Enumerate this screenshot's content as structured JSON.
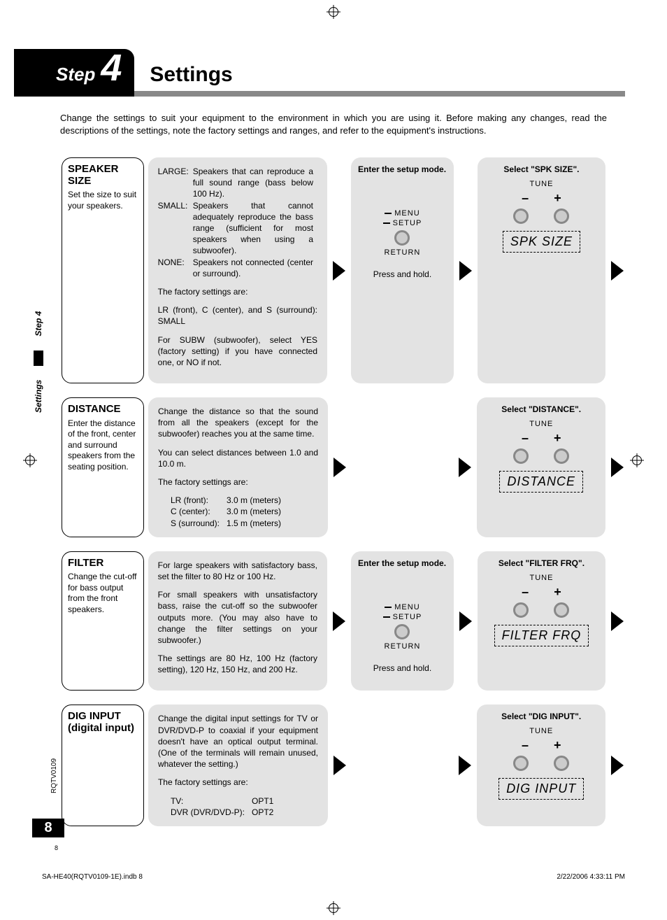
{
  "header": {
    "step_word": "Step",
    "step_num": "4",
    "title": "Settings"
  },
  "intro": "Change the settings to suit your equipment to the environment in which you are using it. Before making any changes, read the descriptions of the settings, note the factory settings and ranges, and refer to the equipment's instructions.",
  "side": {
    "tab1": "Settings",
    "tab2": "Step 4",
    "doc_code": "RQTV0109",
    "page_num": "8",
    "page_num_small": "8"
  },
  "setup_panel": {
    "title": "Enter the setup mode.",
    "menu": "MENU",
    "setup": "SETUP",
    "return": "RETURN",
    "hint": "Press and hold."
  },
  "controls": {
    "tune": "TUNE",
    "minus": "–",
    "plus": "+"
  },
  "rows": [
    {
      "left_title": "SPEAKER SIZE",
      "left_desc": "Set the size to suit your speakers.",
      "defs": [
        {
          "k": "LARGE:",
          "v": "Speakers that can reproduce a full sound range (bass below 100 Hz)."
        },
        {
          "k": "SMALL:",
          "v": "Speakers that cannot adequately reproduce the bass range (sufficient for most speakers when using a subwoofer)."
        },
        {
          "k": "NONE:",
          "v": "Speakers not connected (center or surround)."
        }
      ],
      "para1": "The factory settings are:",
      "para2": "LR (front), C (center), and S (surround): SMALL",
      "para3": "For SUBW (subwoofer), select YES (factory setting) if you have connected one, or NO if not.",
      "right_title": "Select \"SPK SIZE\".",
      "display": "SPK SIZE",
      "show_setup": true
    },
    {
      "left_title": "DISTANCE",
      "left_desc": "Enter the distance of the front, center and surround speakers from the seating position.",
      "paraA": "Change the distance so that the sound from all the speakers (except for the subwoofer) reaches you at the same time.",
      "paraB": "You can select distances between 1.0 and 10.0 m.",
      "paraC": "The factory settings are:",
      "tbl": [
        {
          "k": "LR (front):",
          "v": "3.0 m (meters)"
        },
        {
          "k": "C (center):",
          "v": "3.0 m (meters)"
        },
        {
          "k": "S (surround):",
          "v": "1.5 m (meters)"
        }
      ],
      "right_title": "Select \"DISTANCE\".",
      "display": "DISTANCE",
      "show_setup": false
    },
    {
      "left_title": "FILTER",
      "left_desc": "Change the cut-off for bass output from the front speakers.",
      "paraA": "For large speakers with satisfactory bass, set the filter to 80 Hz or 100 Hz.",
      "paraB": "For small speakers with unsatisfactory bass, raise the cut-off so the subwoofer outputs more. (You may also have to change the filter settings on your subwoofer.)",
      "paraC": "The settings are 80 Hz, 100 Hz (factory setting), 120 Hz, 150 Hz, and 200 Hz.",
      "right_title": "Select \"FILTER FRQ\".",
      "display": "FILTER FRQ",
      "show_setup": true
    },
    {
      "left_title": "DIG INPUT (digital input)",
      "left_desc": "",
      "paraA": "Change the digital input settings for TV or DVR/DVD-P to coaxial if your equipment doesn't have an optical output terminal. (One of the terminals will remain unused, whatever the setting.)",
      "paraB": "The factory settings are:",
      "tbl": [
        {
          "k": "TV:",
          "v": "OPT1"
        },
        {
          "k": "DVR (DVR/DVD-P):",
          "v": "OPT2"
        }
      ],
      "right_title": "Select \"DIG INPUT\".",
      "display": "DIG INPUT",
      "show_setup": false
    }
  ],
  "footer": {
    "left": "SA-HE40(RQTV0109-1E).indb   8",
    "right": "2/22/2006   4:33:11 PM"
  }
}
